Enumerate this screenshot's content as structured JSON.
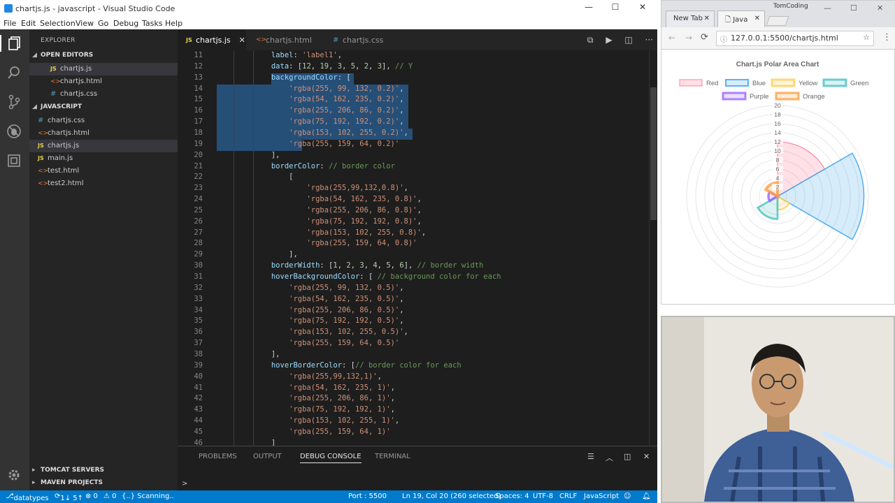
{
  "window": {
    "title": "chartjs.js - javascript - Visual Studio Code",
    "minimize": "—",
    "maximize": "☐",
    "close": "✕"
  },
  "menu": [
    "File",
    "Edit",
    "Selection",
    "View",
    "Go",
    "Debug",
    "Tasks",
    "Help"
  ],
  "explorer": {
    "header": "EXPLORER",
    "open_editors_label": "OPEN EDITORS",
    "open_editors": [
      {
        "name": "chartjs.js",
        "type": "js"
      },
      {
        "name": "chartjs.html",
        "type": "html"
      },
      {
        "name": "chartjs.css",
        "type": "css"
      }
    ],
    "folder_label": "JAVASCRIPT",
    "files": [
      {
        "name": "chartjs.css",
        "type": "css"
      },
      {
        "name": "chartjs.html",
        "type": "html"
      },
      {
        "name": "chartjs.js",
        "type": "js"
      },
      {
        "name": "main.js",
        "type": "js"
      },
      {
        "name": "test.html",
        "type": "html"
      },
      {
        "name": "test2.html",
        "type": "html"
      }
    ],
    "tomcat_label": "TOMCAT SERVERS",
    "maven_label": "MAVEN PROJECTS"
  },
  "tabs": [
    {
      "label": "chartjs.js",
      "type": "js",
      "active": true
    },
    {
      "label": "chartjs.html",
      "type": "html",
      "active": false
    },
    {
      "label": "chartjs.css",
      "type": "css",
      "active": false
    }
  ],
  "icons": {
    "js": "JS",
    "html": "<>",
    "css": "#",
    "tab_close": "✕",
    "caret_open": "◢",
    "caret_closed": "▸"
  },
  "code_lines": [
    {
      "n": "11",
      "text": "            label: 'label1',"
    },
    {
      "n": "12",
      "text": "            data: [12, 19, 3, 5, 2, 3], // Y"
    },
    {
      "n": "13",
      "text": "            backgroundColor: ["
    },
    {
      "n": "14",
      "text": "                'rgba(255, 99, 132, 0.2)',"
    },
    {
      "n": "15",
      "text": "                'rgba(54, 162, 235, 0.2)',"
    },
    {
      "n": "16",
      "text": "                'rgba(255, 206, 86, 0.2)',"
    },
    {
      "n": "17",
      "text": "                'rgba(75, 192, 192, 0.2)',"
    },
    {
      "n": "18",
      "text": "                'rgba(153, 102, 255, 0.2)',"
    },
    {
      "n": "19",
      "text": "                'rgba(255, 159, 64, 0.2)'"
    },
    {
      "n": "20",
      "text": "            ],"
    },
    {
      "n": "21",
      "text": "            borderColor: // border color"
    },
    {
      "n": "22",
      "text": "                ["
    },
    {
      "n": "23",
      "text": "                    'rgba(255,99,132,0.8)',"
    },
    {
      "n": "24",
      "text": "                    'rgba(54, 162, 235, 0.8)',"
    },
    {
      "n": "25",
      "text": "                    'rgba(255, 206, 86, 0.8)',"
    },
    {
      "n": "26",
      "text": "                    'rgba(75, 192, 192, 0.8)',"
    },
    {
      "n": "27",
      "text": "                    'rgba(153, 102, 255, 0.8)',"
    },
    {
      "n": "28",
      "text": "                    'rgba(255, 159, 64, 0.8)'"
    },
    {
      "n": "29",
      "text": "                ],"
    },
    {
      "n": "30",
      "text": "            borderWidth: [1, 2, 3, 4, 5, 6], // border width"
    },
    {
      "n": "31",
      "text": "            hoverBackgroundColor: [ // background color for each"
    },
    {
      "n": "32",
      "text": "                'rgba(255, 99, 132, 0.5)',"
    },
    {
      "n": "33",
      "text": "                'rgba(54, 162, 235, 0.5)',"
    },
    {
      "n": "34",
      "text": "                'rgba(255, 206, 86, 0.5)',"
    },
    {
      "n": "35",
      "text": "                'rgba(75, 192, 192, 0.5)',"
    },
    {
      "n": "36",
      "text": "                'rgba(153, 102, 255, 0.5)',"
    },
    {
      "n": "37",
      "text": "                'rgba(255, 159, 64, 0.5)'"
    },
    {
      "n": "38",
      "text": "            ],"
    },
    {
      "n": "39",
      "text": "            hoverBorderColor: [// border color for each"
    },
    {
      "n": "40",
      "text": "                'rgba(255,99,132,1)',"
    },
    {
      "n": "41",
      "text": "                'rgba(54, 162, 235, 1)',"
    },
    {
      "n": "42",
      "text": "                'rgba(255, 206, 86, 1)',"
    },
    {
      "n": "43",
      "text": "                'rgba(75, 192, 192, 1)',"
    },
    {
      "n": "44",
      "text": "                'rgba(153, 102, 255, 1)',"
    },
    {
      "n": "45",
      "text": "                'rgba(255, 159, 64, 1)'"
    },
    {
      "n": "46",
      "text": "            ]"
    }
  ],
  "panel": {
    "tabs": [
      "PROBLEMS",
      "OUTPUT",
      "DEBUG CONSOLE",
      "TERMINAL"
    ],
    "active_tab": "DEBUG CONSOLE",
    "prompt": ">"
  },
  "statusbar": {
    "branch": "datatypes",
    "sync": "1↓ 5↑",
    "errors": "⊗ 0",
    "warnings": "⚠ 0",
    "scanning": "{..} Scanning..",
    "port": "Port : 5500",
    "cursor": "Ln 19, Col 20 (260 selected)",
    "spaces": "Spaces: 4",
    "encoding": "UTF-8",
    "eol": "CRLF",
    "language": "JavaScript",
    "colors": {
      "bar": "#007acc"
    }
  },
  "browser": {
    "profile": "TomCoding",
    "tabs": [
      {
        "label": "New Tab",
        "active": false
      },
      {
        "label": "Java",
        "active": true
      }
    ],
    "url": "127.0.0.1:5500/chartjs.html"
  },
  "chart_data": {
    "type": "polarArea",
    "title": "Chart.js Polar Area Chart",
    "legend_position": "top",
    "legend": [
      "Red",
      "Blue",
      "Yellow",
      "Green",
      "Purple",
      "Orange"
    ],
    "values": [
      12,
      19,
      3,
      5,
      2,
      3
    ],
    "r_ticks": [
      "2",
      "4",
      "6",
      "8",
      "10",
      "12",
      "14",
      "16",
      "18",
      "20"
    ],
    "r_max": 20,
    "colors": {
      "fill": [
        "rgba(255,99,132,0.2)",
        "rgba(54,162,235,0.2)",
        "rgba(255,206,86,0.2)",
        "rgba(75,192,192,0.2)",
        "rgba(153,102,255,0.2)",
        "rgba(255,159,64,0.2)"
      ],
      "border": [
        "rgba(255,99,132,0.8)",
        "rgba(54,162,235,0.8)",
        "rgba(255,206,86,0.8)",
        "rgba(75,192,192,0.8)",
        "rgba(153,102,255,0.8)",
        "rgba(255,159,64,0.8)"
      ]
    },
    "border_widths": [
      1,
      2,
      3,
      4,
      5,
      6
    ],
    "grid": true
  },
  "colors": {
    "editor_bg": "#1e1e1e",
    "selection": "#264f78",
    "keyword": "#9cdcfe",
    "string": "#ce9178",
    "number": "#b5cea8",
    "comment": "#6a9955"
  }
}
